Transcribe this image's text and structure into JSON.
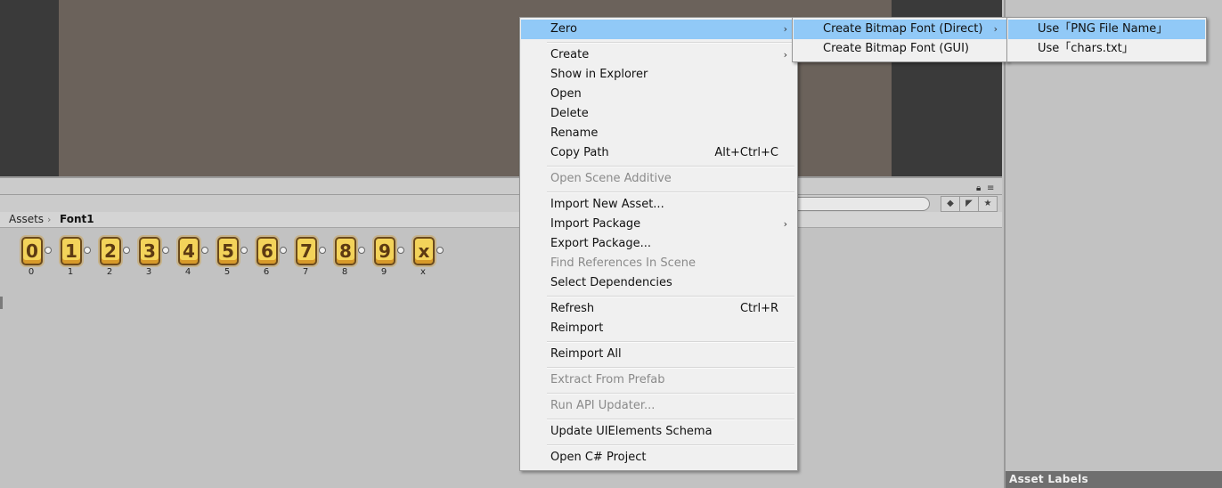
{
  "project": {
    "breadcrumb": {
      "root": "Assets",
      "separator": "›",
      "current": "Font1"
    },
    "assets": [
      {
        "glyph": "0",
        "label": "0"
      },
      {
        "glyph": "1",
        "label": "1"
      },
      {
        "glyph": "2",
        "label": "2"
      },
      {
        "glyph": "3",
        "label": "3"
      },
      {
        "glyph": "4",
        "label": "4"
      },
      {
        "glyph": "5",
        "label": "5"
      },
      {
        "glyph": "6",
        "label": "6"
      },
      {
        "glyph": "7",
        "label": "7"
      },
      {
        "glyph": "8",
        "label": "8"
      },
      {
        "glyph": "9",
        "label": "9"
      },
      {
        "glyph": "x",
        "label": "x"
      }
    ]
  },
  "inspector": {
    "asset_labels": "Asset Labels"
  },
  "context_menu": {
    "zero": "Zero",
    "create": "Create",
    "show_in_explorer": "Show in Explorer",
    "open": "Open",
    "delete": "Delete",
    "rename": "Rename",
    "copy_path": "Copy Path",
    "copy_path_shortcut": "Alt+Ctrl+C",
    "open_scene_additive": "Open Scene Additive",
    "import_new_asset": "Import New Asset...",
    "import_package": "Import Package",
    "export_package": "Export Package...",
    "find_references": "Find References In Scene",
    "select_dependencies": "Select Dependencies",
    "refresh": "Refresh",
    "refresh_shortcut": "Ctrl+R",
    "reimport": "Reimport",
    "reimport_all": "Reimport All",
    "extract_from_prefab": "Extract From Prefab",
    "run_api_updater": "Run API Updater...",
    "update_uielements": "Update UIElements Schema",
    "open_csharp_project": "Open C# Project",
    "submenu_arrow": "›"
  },
  "zero_submenu": {
    "direct": "Create Bitmap Font (Direct)",
    "gui": "Create Bitmap Font (GUI)"
  },
  "direct_submenu": {
    "use_png": "Use「PNG File Name」",
    "use_chars": "Use「chars.txt」"
  },
  "icons": {
    "lock": "lock-icon",
    "menu": "panel-menu-icon",
    "filter_type": "filter-by-type-icon",
    "filter_label": "filter-by-label-icon",
    "favorite": "favorite-star-icon"
  },
  "colors": {
    "highlight": "#91c9f7",
    "menu_bg": "#f0f0f0"
  }
}
